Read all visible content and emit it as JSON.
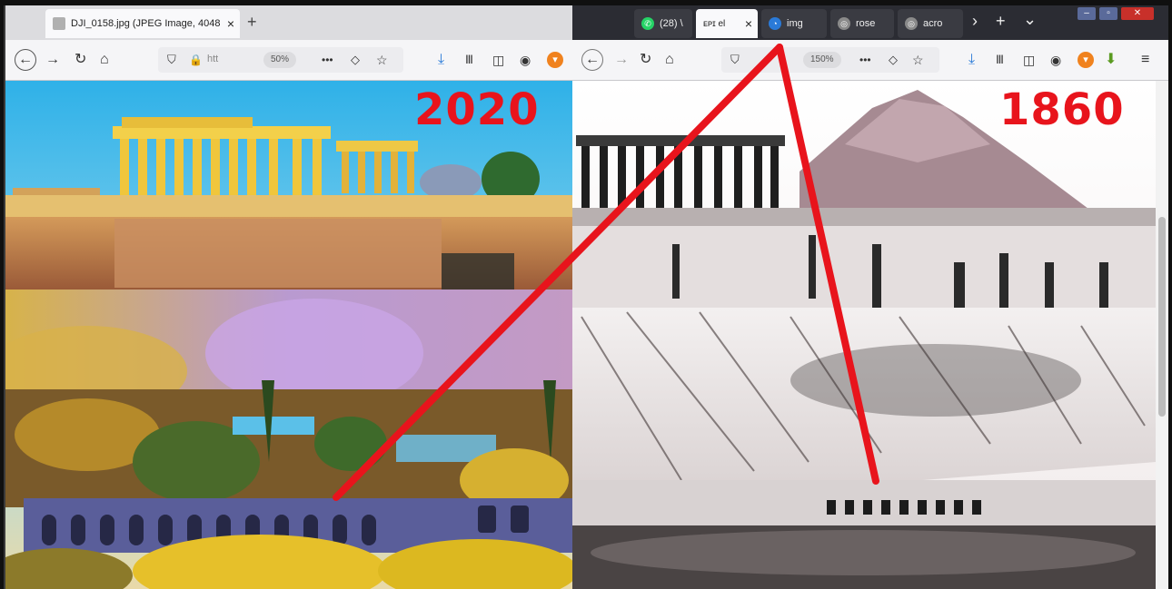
{
  "left_window": {
    "tab_title": "DJI_0158.jpg (JPEG Image, 4048",
    "tab_close": "×",
    "new_tab": "+",
    "url_text": "htt",
    "zoom": "50%",
    "more": "•••",
    "year_label": "2020"
  },
  "right_window": {
    "tabs": [
      {
        "label": "(28) \\",
        "icon": "whatsapp-icon",
        "color": "#25d366"
      },
      {
        "label": "ᴇᴘɪ el",
        "icon": "site-icon",
        "color": "#ffffff"
      },
      {
        "label": "img",
        "icon": "image-search-icon",
        "color": "#2a7ad8"
      },
      {
        "label": "rose",
        "icon": "chrome-globe-icon",
        "color": "#8a8a8a"
      },
      {
        "label": "acro",
        "icon": "chrome-globe-icon",
        "color": "#8a8a8a"
      }
    ],
    "tab_close": "×",
    "overflow": "›",
    "new_tab": "+",
    "list_all": "⌄",
    "zoom": "150%",
    "more": "•••",
    "year_label": "1860"
  },
  "colors": {
    "annotation_red": "#e8141c",
    "label_red": "#e8141c"
  }
}
